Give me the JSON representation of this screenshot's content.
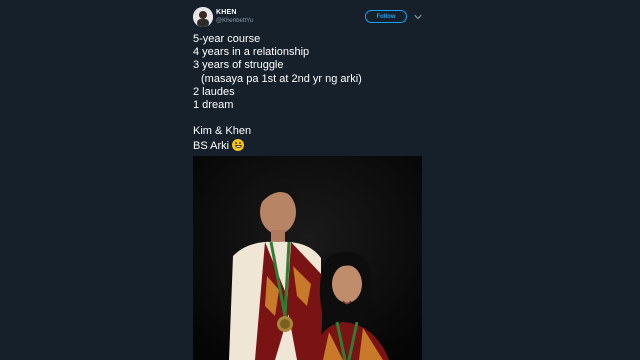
{
  "tweet": {
    "author": {
      "display_name": "KHEN",
      "handle": "@KhenbettYu",
      "avatar_icon": "avatar-photo"
    },
    "follow_label": "Follow",
    "menu_icon": "chevron-down-icon",
    "text_lines": [
      "5-year course",
      "4 years in a relationship",
      "3 years of struggle",
      "(masaya pa 1st at 2nd yr ng arki)",
      "2 laudes",
      "1 dream",
      "",
      "Kim & Khen",
      "BS Arki"
    ],
    "emoji": "grinning-face-emoji",
    "media": {
      "type": "photo"
    }
  },
  "colors": {
    "background": "#15202b",
    "accent": "#1da1f2",
    "secondary_text": "#8899a6"
  }
}
